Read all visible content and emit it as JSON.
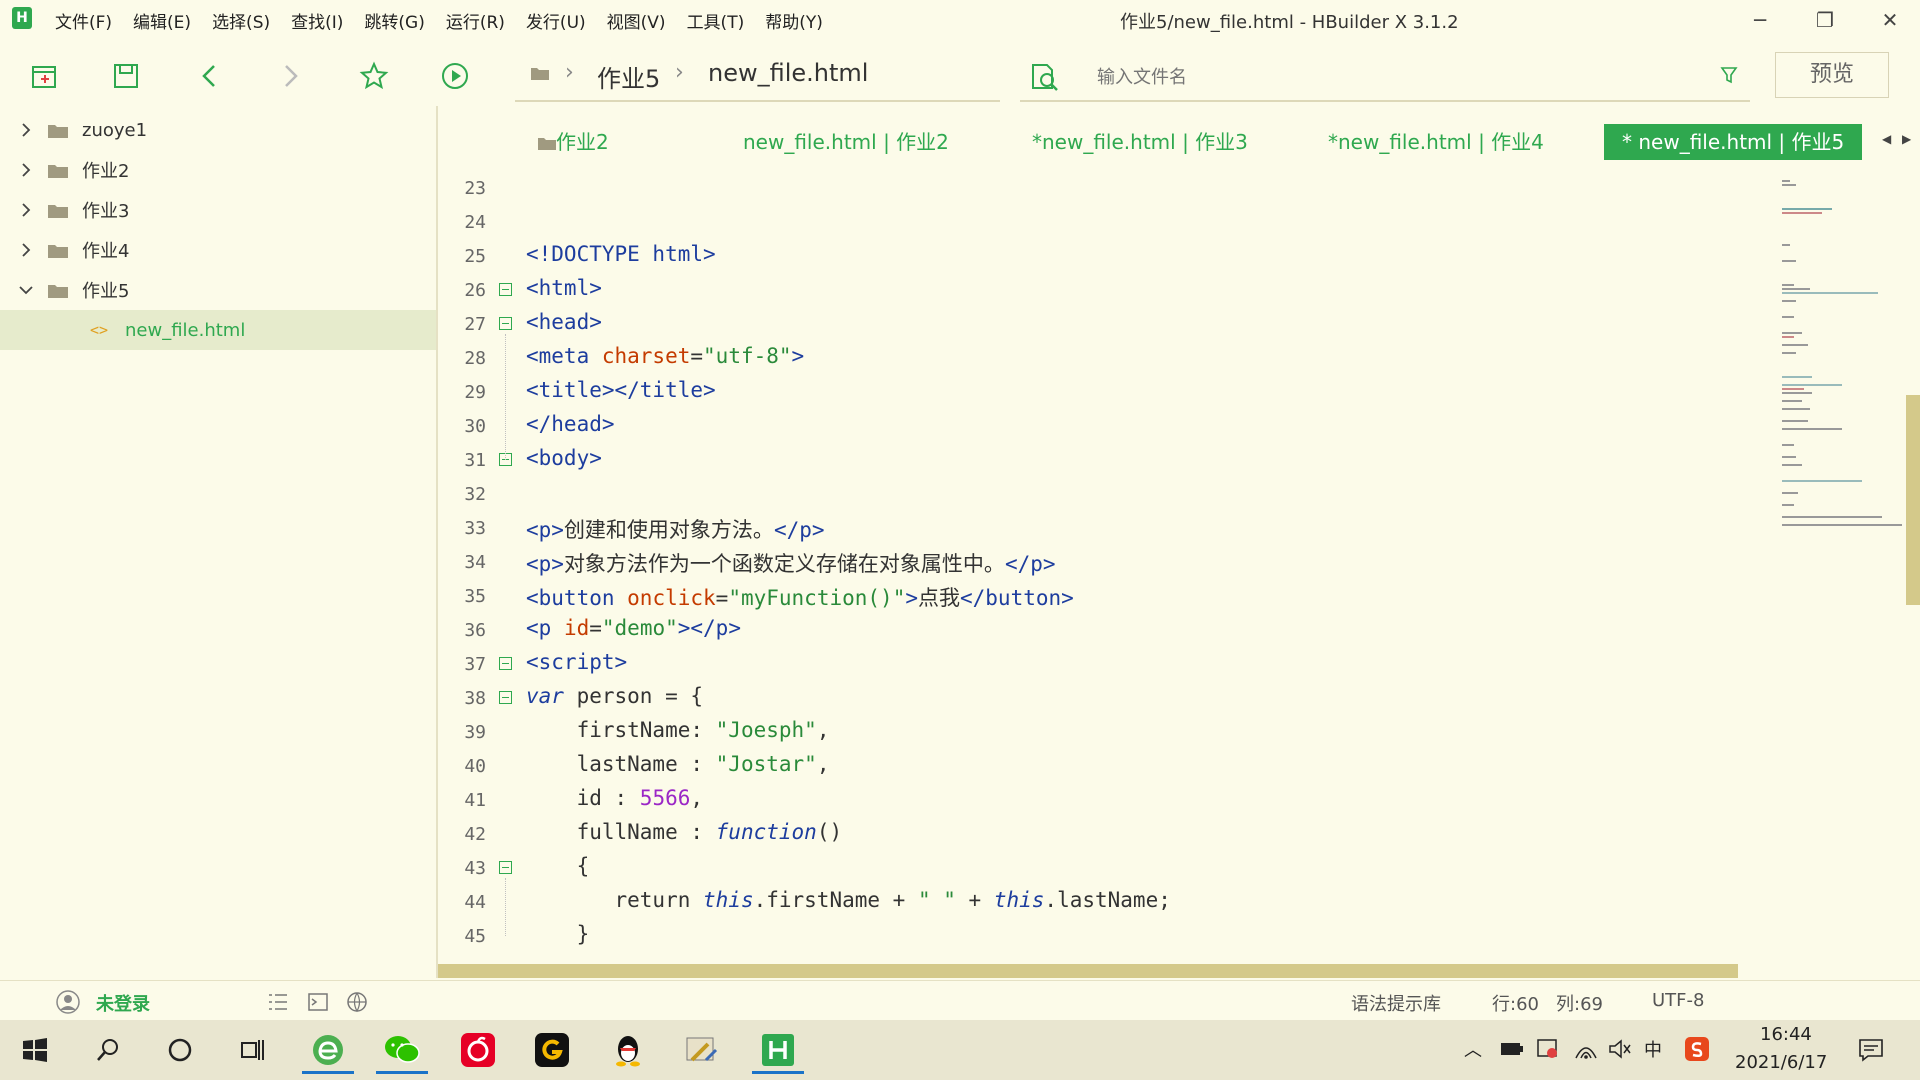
{
  "menu": [
    "文件(F)",
    "编辑(E)",
    "选择(S)",
    "查找(I)",
    "跳转(G)",
    "运行(R)",
    "发行(U)",
    "视图(V)",
    "工具(T)",
    "帮助(Y)"
  ],
  "window_title": "作业5/new_file.html - HBuilder X 3.1.2",
  "breadcrumb": {
    "folder": "作业5",
    "file": "new_file.html"
  },
  "search": {
    "placeholder": "输入文件名"
  },
  "preview_label": "预览",
  "sidebar": {
    "folders": [
      "zuoye1",
      "作业2",
      "作业3",
      "作业4",
      "作业5"
    ],
    "open_file": "new_file.html"
  },
  "tabs": [
    "作业2",
    "new_file.html | 作业2",
    "*new_file.html | 作业3",
    "*new_file.html | 作业4",
    "* new_file.html | 作业5"
  ],
  "code_lines": [
    {
      "n": "23",
      "segs": []
    },
    {
      "n": "24",
      "segs": []
    },
    {
      "n": "25",
      "segs": [
        [
          "t-tag",
          "<!DOCTYPE html>"
        ]
      ]
    },
    {
      "n": "26",
      "fold": true,
      "segs": [
        [
          "t-tag",
          "<html>"
        ]
      ]
    },
    {
      "n": "27",
      "fold": true,
      "segs": [
        [
          "t-tag",
          "<head>"
        ]
      ]
    },
    {
      "n": "28",
      "segs": [
        [
          "t-tag",
          "<meta "
        ],
        [
          "t-attr",
          "charset"
        ],
        [
          "t-plain",
          "="
        ],
        [
          "t-str",
          "\"utf-8\""
        ],
        [
          "t-tag",
          ">"
        ]
      ]
    },
    {
      "n": "29",
      "segs": [
        [
          "t-tag",
          "<title></title>"
        ]
      ]
    },
    {
      "n": "30",
      "segs": [
        [
          "t-tag",
          "</head>"
        ]
      ]
    },
    {
      "n": "31",
      "fold": true,
      "segs": [
        [
          "t-tag",
          "<body>"
        ]
      ]
    },
    {
      "n": "32",
      "segs": []
    },
    {
      "n": "33",
      "segs": [
        [
          "t-tag",
          "<p>"
        ],
        [
          "t-plain",
          "创建和使用对象方法。"
        ],
        [
          "t-tag",
          "</p>"
        ]
      ]
    },
    {
      "n": "34",
      "segs": [
        [
          "t-tag",
          "<p>"
        ],
        [
          "t-plain",
          "对象方法作为一个函数定义存储在对象属性中。"
        ],
        [
          "t-tag",
          "</p>"
        ]
      ]
    },
    {
      "n": "35",
      "segs": [
        [
          "t-tag",
          "<button "
        ],
        [
          "t-attr",
          "onclick"
        ],
        [
          "t-plain",
          "="
        ],
        [
          "t-str",
          "\"myFunction()\""
        ],
        [
          "t-tag",
          ">"
        ],
        [
          "t-plain",
          "点我"
        ],
        [
          "t-tag",
          "</button>"
        ]
      ]
    },
    {
      "n": "36",
      "segs": [
        [
          "t-tag",
          "<p "
        ],
        [
          "t-attr",
          "id"
        ],
        [
          "t-plain",
          "="
        ],
        [
          "t-str",
          "\"demo\""
        ],
        [
          "t-tag",
          "></p>"
        ]
      ]
    },
    {
      "n": "37",
      "fold": true,
      "segs": [
        [
          "t-tag",
          "<script>"
        ]
      ]
    },
    {
      "n": "38",
      "fold": true,
      "segs": [
        [
          "t-kw",
          "var"
        ],
        [
          "t-plain",
          " person = {"
        ]
      ]
    },
    {
      "n": "39",
      "segs": [
        [
          "t-plain",
          "    firstName: "
        ],
        [
          "t-str",
          "\"Joesph\""
        ],
        [
          "t-plain",
          ","
        ]
      ]
    },
    {
      "n": "40",
      "segs": [
        [
          "t-plain",
          "    lastName : "
        ],
        [
          "t-str",
          "\"Jostar\""
        ],
        [
          "t-plain",
          ","
        ]
      ]
    },
    {
      "n": "41",
      "segs": [
        [
          "t-plain",
          "    id : "
        ],
        [
          "t-num",
          "5566"
        ],
        [
          "t-plain",
          ","
        ]
      ]
    },
    {
      "n": "42",
      "segs": [
        [
          "t-plain",
          "    fullName : "
        ],
        [
          "t-kw",
          "function"
        ],
        [
          "t-plain",
          "()"
        ]
      ]
    },
    {
      "n": "43",
      "fold": true,
      "segs": [
        [
          "t-plain",
          "    {"
        ]
      ]
    },
    {
      "n": "44",
      "segs": [
        [
          "t-plain",
          "       return "
        ],
        [
          "t-kw",
          "this"
        ],
        [
          "t-plain",
          ".firstName + "
        ],
        [
          "t-str",
          "\" \""
        ],
        [
          "t-plain",
          " + "
        ],
        [
          "t-kw",
          "this"
        ],
        [
          "t-plain",
          ".lastName;"
        ]
      ]
    },
    {
      "n": "45",
      "segs": [
        [
          "t-plain",
          "    }"
        ]
      ]
    }
  ],
  "status": {
    "user": "未登录",
    "syntax_lib": "语法提示库",
    "line": "行:60",
    "col": "列:69",
    "encoding": "UTF-8"
  },
  "taskbar": {
    "time": "16:44",
    "date": "2021/6/17",
    "ime": "中"
  },
  "colors": {
    "accent": "#2fa84f",
    "background": "#fcfbe9",
    "scrollbar": "#d4c98a"
  }
}
